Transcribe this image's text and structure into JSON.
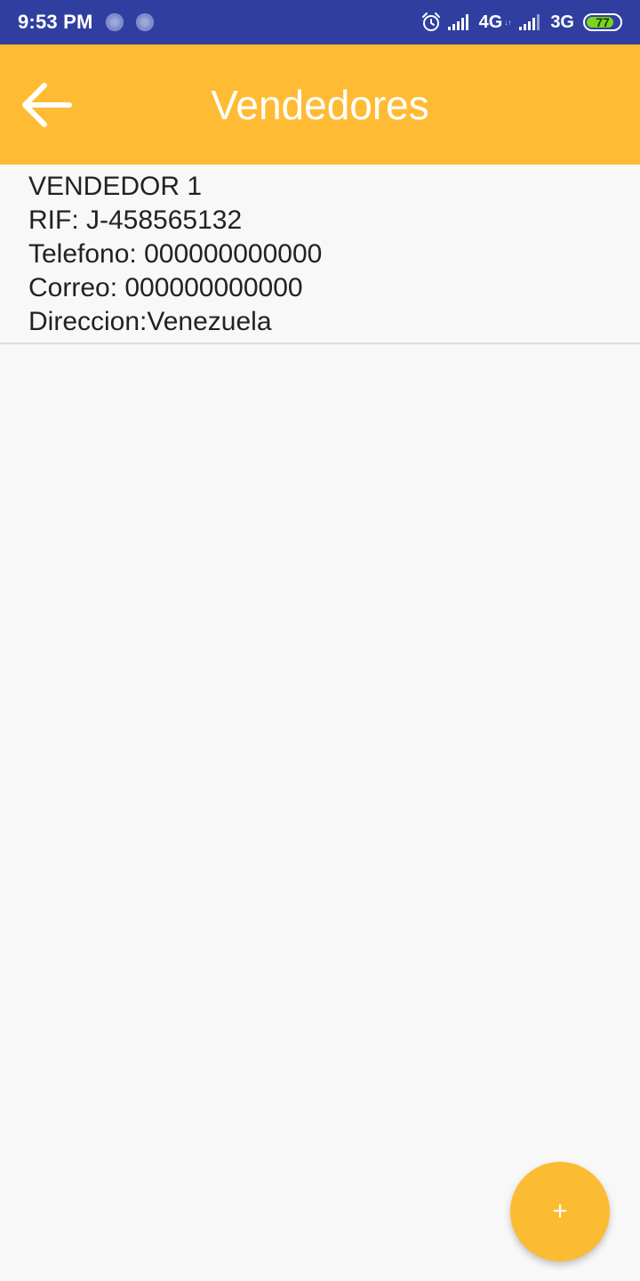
{
  "status_bar": {
    "time": "9:53 PM",
    "network_1": "4G",
    "network_1_sub": "↓↑",
    "network_2": "3G",
    "battery_level": "77",
    "icons": [
      "notification-dot-icon",
      "notification-dot-icon",
      "alarm-icon",
      "signal-icon",
      "signal-icon",
      "battery-icon"
    ]
  },
  "app_bar": {
    "title": "Vendedores",
    "back_icon": "arrow-back-icon",
    "background_color": "#ffbb33"
  },
  "vendors": [
    {
      "name": "VENDEDOR 1",
      "rif": "RIF: J-458565132",
      "telefono": "Telefono: 000000000000",
      "correo": "Correo: 000000000000",
      "direccion": "Direccion:Venezuela"
    }
  ],
  "fab": {
    "label": "+",
    "icon": "add-icon",
    "color": "#fbbc34"
  }
}
